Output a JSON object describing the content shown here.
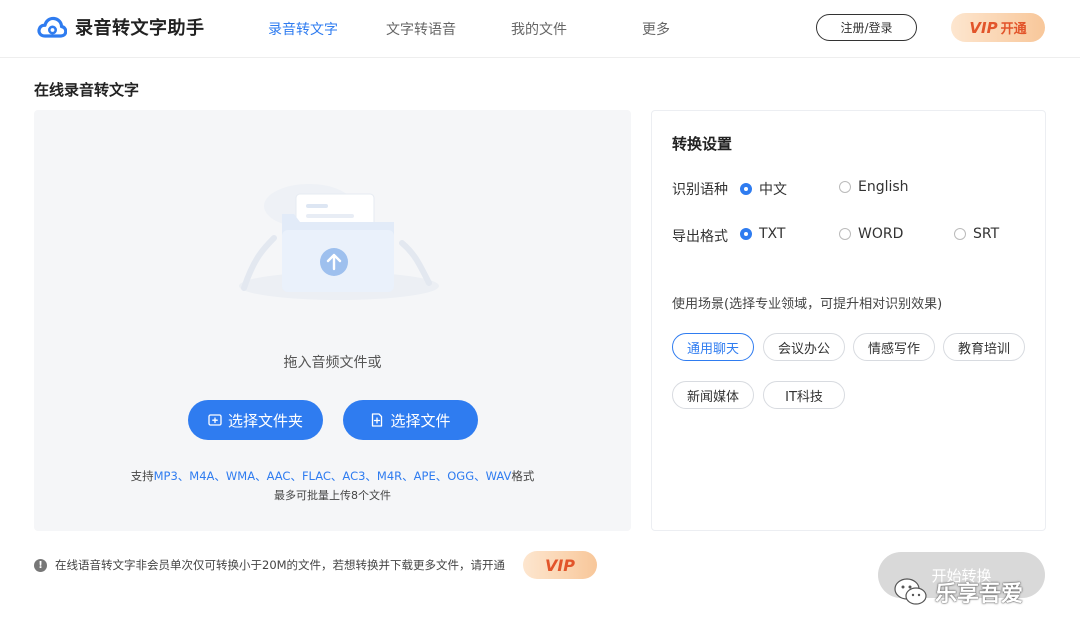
{
  "app": {
    "brand": "录音转文字助手",
    "colors": {
      "accent": "#2f7cf0",
      "vip": "#e2542a",
      "disabled": "#d9d9d9"
    }
  },
  "nav": {
    "items": [
      {
        "label": "录音转文字",
        "active": true
      },
      {
        "label": "文字转语音",
        "active": false
      },
      {
        "label": "我的文件",
        "active": false
      },
      {
        "label": "更多",
        "active": false
      }
    ],
    "login_label": "注册/登录",
    "vip_word": "VIP",
    "vip_open": "开通"
  },
  "page": {
    "title": "在线录音转文字"
  },
  "upload": {
    "drop_hint": "拖入音频文件或",
    "pick_folder_label": "选择文件夹",
    "pick_file_label": "选择文件",
    "support_prefix": "支持",
    "support_formats": "MP3、M4A、WMA、AAC、FLAC、AC3、M4R、APE、OGG、WAV",
    "support_suffix": "格式",
    "limit": "最多可批量上传8个文件"
  },
  "settings": {
    "title": "转换设置",
    "language": {
      "label": "识别语种",
      "options": [
        {
          "label": "中文",
          "checked": true
        },
        {
          "label": "English",
          "checked": false
        }
      ]
    },
    "format": {
      "label": "导出格式",
      "options": [
        {
          "label": "TXT",
          "checked": true
        },
        {
          "label": "WORD",
          "checked": false
        },
        {
          "label": "SRT",
          "checked": false
        }
      ]
    },
    "scene_label": "使用场景(选择专业领域，可提升相对识别效果)",
    "scenes": [
      {
        "label": "通用聊天",
        "active": true
      },
      {
        "label": "会议办公",
        "active": false
      },
      {
        "label": "情感写作",
        "active": false
      },
      {
        "label": "教育培训",
        "active": false
      },
      {
        "label": "新闻媒体",
        "active": false
      },
      {
        "label": "IT科技",
        "active": false
      }
    ]
  },
  "notice": {
    "text": "在线语音转文字非会员单次仅可转换小于20M的文件，若想转换并下载更多文件，请开通",
    "vip_label": "VIP"
  },
  "start_button": {
    "label": "开始转换"
  },
  "watermark": {
    "text": "乐享吾爱"
  }
}
